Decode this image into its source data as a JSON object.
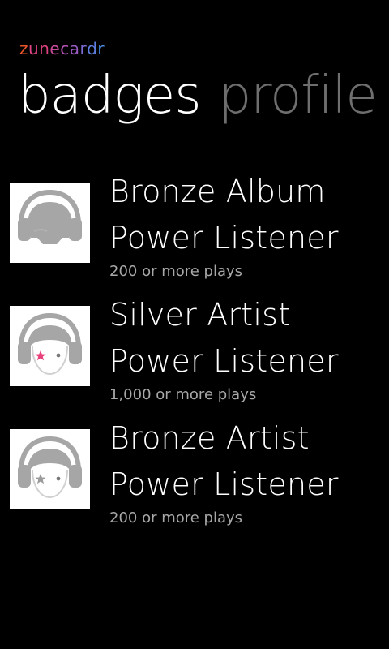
{
  "app": {
    "title_letters": [
      {
        "ch": "z",
        "color": "#e8552a"
      },
      {
        "ch": "u",
        "color": "#e5468a"
      },
      {
        "ch": "n",
        "color": "#d8407e"
      },
      {
        "ch": "e",
        "color": "#c84b9a"
      },
      {
        "ch": "c",
        "color": "#b152b0"
      },
      {
        "ch": "a",
        "color": "#9b5cc4"
      },
      {
        "ch": "r",
        "color": "#7d6ad4"
      },
      {
        "ch": "d",
        "color": "#5e7ee0"
      },
      {
        "ch": "r",
        "color": "#4a8ee8"
      }
    ]
  },
  "pivot": {
    "items": [
      {
        "label": "badges",
        "active": true
      },
      {
        "label": "profile",
        "active": false
      }
    ]
  },
  "badges": [
    {
      "title_line1": "Bronze Album",
      "title_line2": "Power Listener",
      "subtitle": "200 or more plays",
      "icon": "headphones-no-face-icon",
      "star_color": ""
    },
    {
      "title_line1": "Silver Artist",
      "title_line2": "Power Listener",
      "subtitle": "1,000 or more plays",
      "icon": "headphones-pink-star-icon",
      "star_color": "#e8407a"
    },
    {
      "title_line1": "Bronze Artist",
      "title_line2": "Power Listener",
      "subtitle": "200 or more plays",
      "icon": "headphones-gray-star-icon",
      "star_color": "#9a9a9a"
    }
  ],
  "colors": {
    "background": "#000000",
    "text_primary": "#ffffff",
    "text_secondary": "#a8a8a8",
    "pivot_inactive": "#6e6e6e",
    "icon_gray": "#a6a6a6"
  }
}
